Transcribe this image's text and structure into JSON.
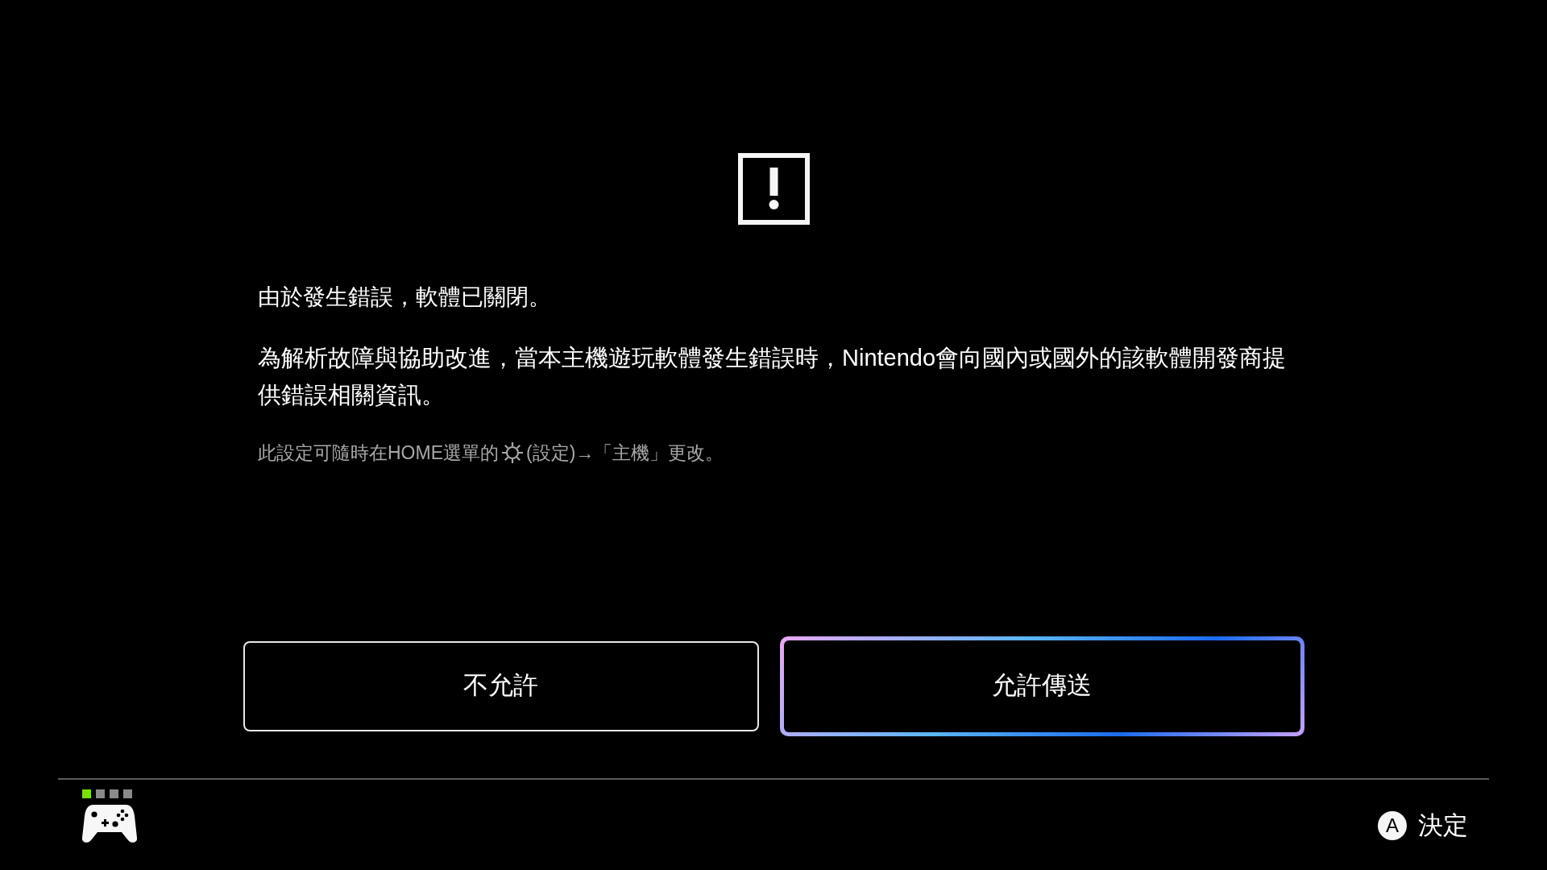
{
  "title": "由於發生錯誤，軟體已關閉。",
  "message": "為解析故障與協助改進，當本主機遊玩軟體發生錯誤時，Nintendo會向國內或國外的該軟體開發商提供錯誤相關資訊。",
  "note": {
    "before": "此設定可隨時在HOME選單的",
    "after": "(設定)→「主機」更改。"
  },
  "buttons": [
    {
      "label": "不允許",
      "selected": false
    },
    {
      "label": "允許傳送",
      "selected": true
    }
  ],
  "player_lights": [
    {
      "on": true
    },
    {
      "on": false
    },
    {
      "on": false
    },
    {
      "on": false
    }
  ],
  "footer": {
    "button": "A",
    "action": "決定"
  }
}
